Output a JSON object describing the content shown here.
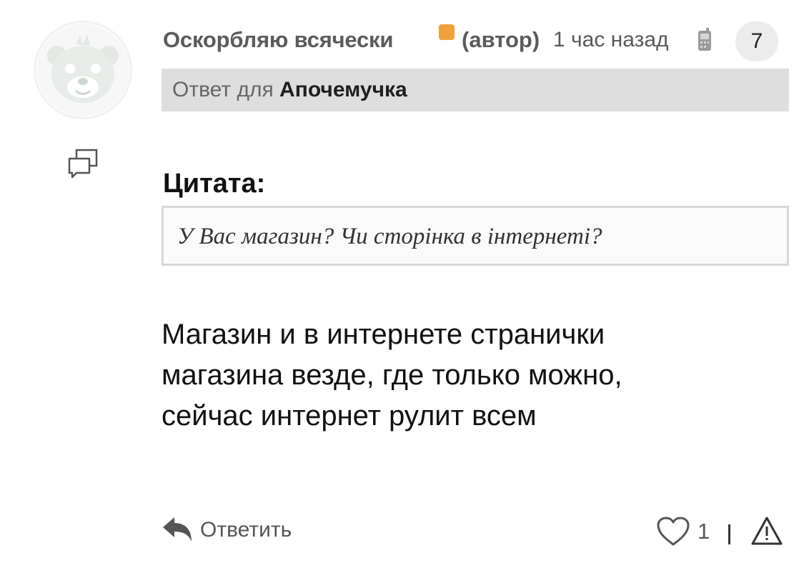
{
  "post": {
    "author_name": "Оскорбляю всячески",
    "author_tag": "(автор)",
    "timestamp": "1 час назад",
    "comment_count": "7",
    "status_color": "#f0a13c",
    "reply_to_prefix": "Ответ для",
    "reply_to_name": "Апочемучка",
    "quote_label": "Цитата:",
    "quote_text": "У Вас магазин? Чи сторінка в інтернеті?",
    "message_lines": [
      "Магазин и в интернете странички",
      "магазина везде, где только можно,",
      "сейчас интернет рулит всем"
    ]
  },
  "actions": {
    "reply_label": "Ответить",
    "like_count": "1",
    "divider": "|"
  },
  "icons": {
    "avatar": "bear-avatar",
    "threads": "threads-icon",
    "device": "mobile-phone-icon",
    "reply": "reply-arrow-icon",
    "like": "heart-icon",
    "report": "warning-triangle-icon"
  }
}
